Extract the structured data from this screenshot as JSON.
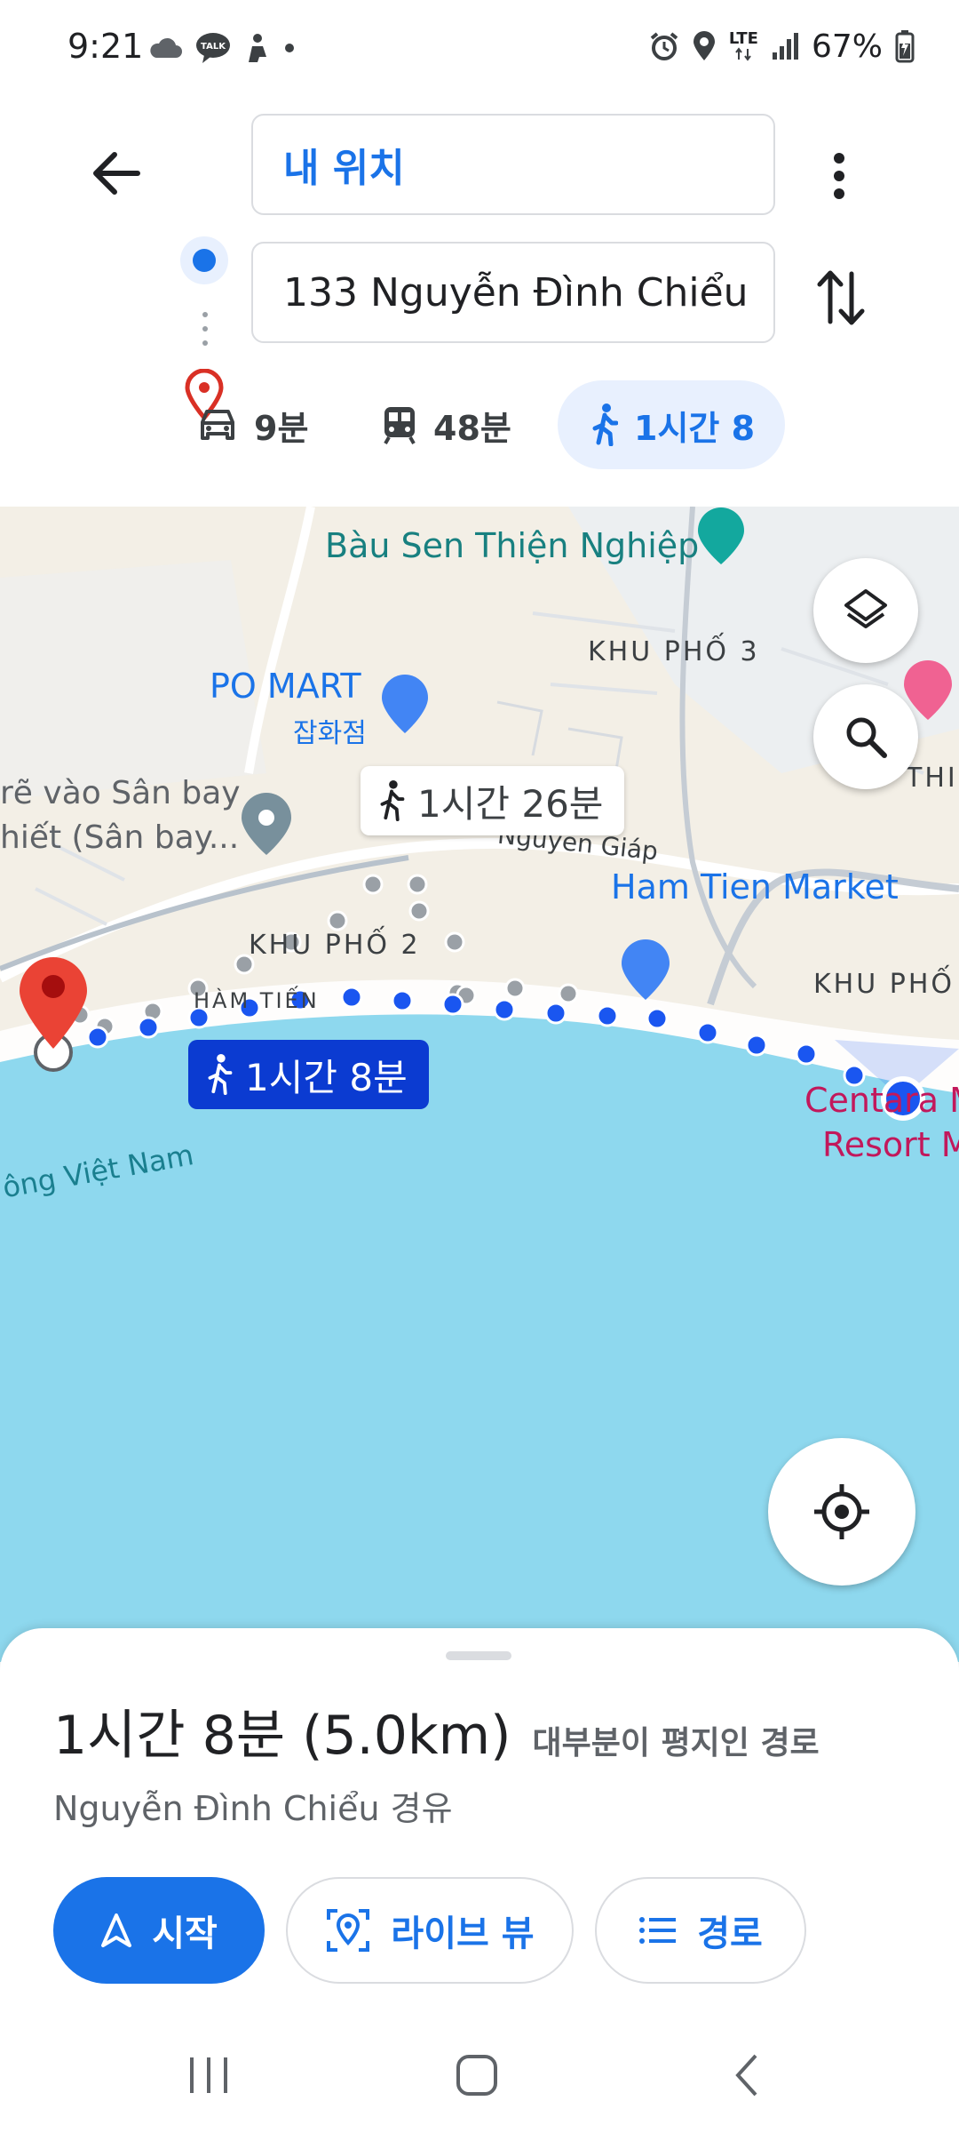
{
  "status_bar": {
    "time": "9:21",
    "network": "LTE",
    "battery": "67%",
    "left_icons": [
      "cloud-icon",
      "kakaotalk-icon",
      "notification-icon",
      "dot-icon"
    ],
    "right_icons": [
      "alarm-icon",
      "location-icon",
      "signal-icon",
      "battery-icon"
    ]
  },
  "directions": {
    "origin": "내 위치",
    "destination": "133 Nguyễn Đình Chiểu",
    "modes": [
      {
        "name": "drive",
        "label": "9분",
        "icon": "car-icon"
      },
      {
        "name": "transit",
        "label": "48분",
        "icon": "train-icon"
      },
      {
        "name": "walk",
        "label": "1시간 8",
        "icon": "walk-icon",
        "selected": true
      }
    ]
  },
  "map": {
    "labels": {
      "bau_sen": "Bàu Sen Thiện Nghiệp",
      "khu_pho_3": "KHU PHỐ 3",
      "po_mart": "PO MART",
      "po_mart_sub": "잡화점",
      "airport_line1": "rẽ vào Sân bay",
      "airport_line2": "hiết (Sân bay...",
      "thi": "THI",
      "nguyen_giap": "Nguyen Giáp",
      "ham_tien_market": "Ham Tien Market",
      "khu_pho_2": "KHU PHỐ 2",
      "khu_pho_right": "KHU PHỐ",
      "ham_tien": "HÀM TIẾN",
      "centara_line1": "Centara M",
      "centara_line2": "Resort M",
      "sea": "ông Việt Nam"
    },
    "alt_route_label": "1시간 26분",
    "main_route_label": "1시간 8분",
    "colors": {
      "water": "#8ed8ee",
      "land": "#f3efe6",
      "route": "#1a56f0",
      "alt_route": "#9aa0a6"
    }
  },
  "route": {
    "summary": "1시간 8분 (5.0km)",
    "note": "대부분이 평지인 경로",
    "via": "Nguyễn Đình Chiểu 경유",
    "start_label": "시작",
    "live_view_label": "라이브 뷰",
    "steps_label": "경로"
  },
  "nav": {
    "items": [
      "recent-apps-button",
      "home-button",
      "back-button"
    ]
  }
}
